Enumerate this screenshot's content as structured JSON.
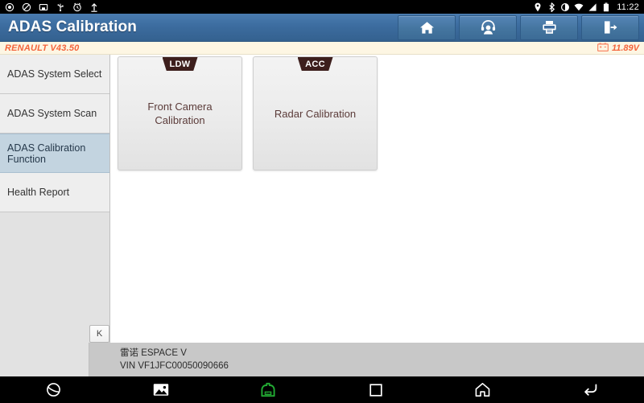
{
  "status_bar": {
    "left_icons": [
      {
        "name": "record-icon",
        "glyph": "record"
      },
      {
        "name": "do-not-disturb-icon",
        "glyph": "dnd"
      },
      {
        "name": "screenshot-icon",
        "glyph": "screenshot"
      },
      {
        "name": "usb-icon",
        "glyph": "usb"
      },
      {
        "name": "alarm-icon",
        "glyph": "alarm"
      },
      {
        "name": "upload-icon",
        "glyph": "upload"
      }
    ],
    "right_icons": [
      {
        "name": "location-icon",
        "glyph": "location"
      },
      {
        "name": "bluetooth-icon",
        "glyph": "bluetooth"
      },
      {
        "name": "brightness-icon",
        "glyph": "brightness"
      },
      {
        "name": "wifi-icon",
        "glyph": "wifi"
      },
      {
        "name": "cell-signal-icon",
        "glyph": "signal"
      },
      {
        "name": "battery-icon",
        "glyph": "battery"
      }
    ],
    "time": "11:22"
  },
  "header": {
    "title": "ADAS Calibration",
    "buttons": [
      {
        "name": "home-button",
        "icon": "home-icon",
        "label": "Home"
      },
      {
        "name": "support-button",
        "icon": "headset-icon",
        "label": "Support"
      },
      {
        "name": "print-button",
        "icon": "printer-icon",
        "label": "Print"
      },
      {
        "name": "exit-button",
        "icon": "exit-icon",
        "label": "Exit"
      }
    ]
  },
  "version_bar": {
    "software_version": "RENAULT V43.50",
    "voltage": "11.89V",
    "voltage_icon": "car-battery-icon",
    "accent_color": "#f4643c"
  },
  "sidebar": {
    "items": [
      {
        "label": "ADAS System Select",
        "selected": false
      },
      {
        "label": "ADAS System Scan",
        "selected": false
      },
      {
        "label": "ADAS Calibration Function",
        "selected": true
      },
      {
        "label": "Health Report",
        "selected": false
      }
    ],
    "selected_color": "#c3d4e0",
    "collapse_button_label": "K"
  },
  "main": {
    "cards": [
      {
        "badge": "LDW",
        "title": "Front Camera Calibration"
      },
      {
        "badge": "ACC",
        "title": "Radar Calibration"
      }
    ],
    "badge_color": "#3d1f1d",
    "card_text_color": "#5b3b39"
  },
  "vehicle_info": {
    "model": "雷诺 ESPACE V",
    "vin": "VIN VF1JFC00050090666"
  },
  "nav_bar": {
    "buttons": [
      {
        "name": "browser-button",
        "icon": "browser-icon"
      },
      {
        "name": "gallery-button",
        "icon": "image-icon"
      },
      {
        "name": "vci-button",
        "icon": "vci-connector-icon",
        "color": "#22aa33"
      },
      {
        "name": "recents-button",
        "icon": "square-icon"
      },
      {
        "name": "home-nav-button",
        "icon": "home-outline-icon"
      },
      {
        "name": "back-button",
        "icon": "back-arrow-icon"
      }
    ]
  }
}
